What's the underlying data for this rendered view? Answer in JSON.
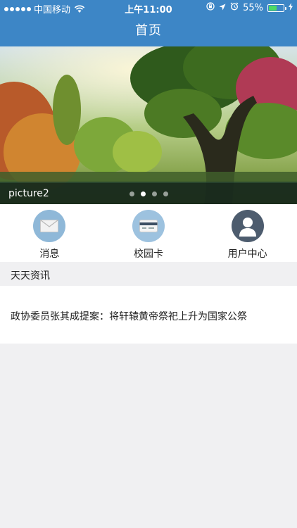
{
  "status_bar": {
    "carrier": "中国移动",
    "time": "上午11:00",
    "battery_percent": "55%",
    "battery_level": 0.55
  },
  "nav": {
    "title": "首页"
  },
  "banner": {
    "caption": "picture2",
    "dots": 4,
    "active_dot": 1
  },
  "actions": [
    {
      "label": "消息",
      "icon": "envelope-icon"
    },
    {
      "label": "校园卡",
      "icon": "card-icon"
    },
    {
      "label": "用户中心",
      "icon": "user-icon"
    }
  ],
  "news_section": {
    "title": "天天资讯",
    "items": [
      {
        "text": "政协委员张其成提案：将轩辕黄帝祭祀上升为国家公祭"
      }
    ]
  },
  "colors": {
    "nav_bar": "#3d86c6",
    "battery": "#4cd964"
  }
}
